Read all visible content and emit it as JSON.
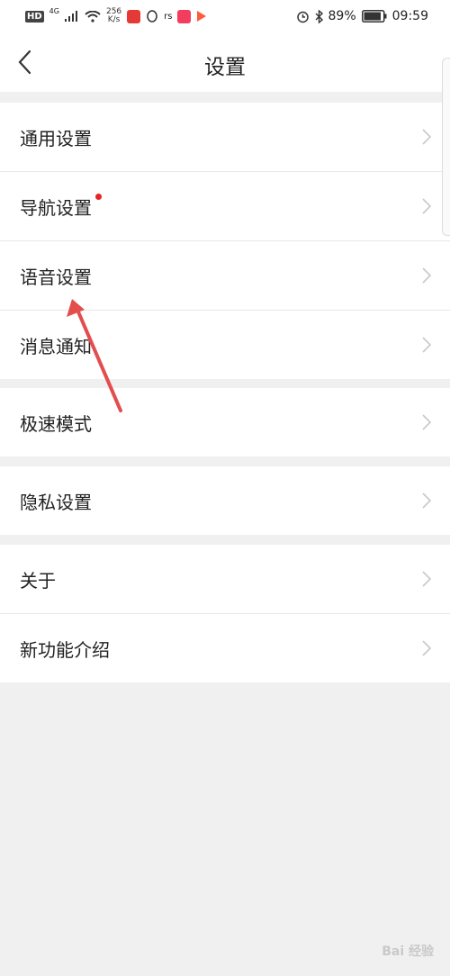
{
  "status_bar": {
    "signal_label": "HD",
    "network_type": "4G",
    "speed_value": "256",
    "speed_unit": "K/s",
    "battery": "89%",
    "time": "09:59"
  },
  "header": {
    "title": "设置"
  },
  "groups": [
    [
      {
        "label": "通用设置"
      },
      {
        "label": "导航设置",
        "badge": true
      },
      {
        "label": "语音设置"
      },
      {
        "label": "消息通知"
      }
    ],
    [
      {
        "label": "极速模式"
      }
    ],
    [
      {
        "label": "隐私设置"
      }
    ],
    [
      {
        "label": "关于"
      },
      {
        "label": "新功能介绍"
      }
    ]
  ],
  "colors": {
    "badge": "#e52424",
    "annotation_arrow": "#e34d4d",
    "background": "#f0f0f0"
  },
  "watermark": "Bai 经验"
}
